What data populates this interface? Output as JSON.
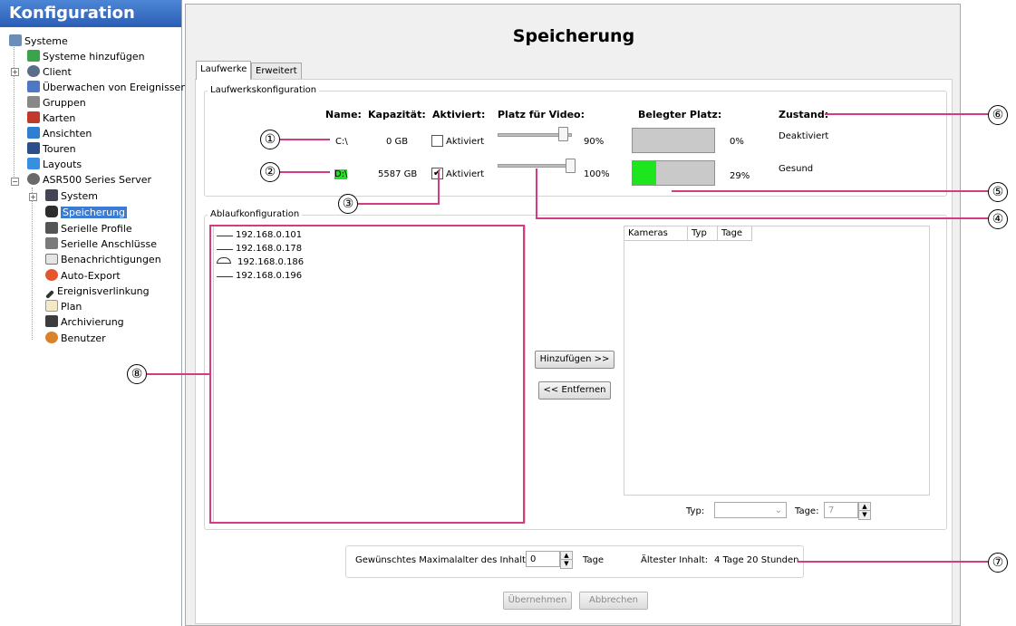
{
  "sidebar": {
    "title": "Konfiguration",
    "items": [
      {
        "label": "Systeme",
        "icon": "systems-icon"
      },
      {
        "label": "Systeme hinzufügen",
        "icon": "add-system-icon"
      },
      {
        "label": "Client",
        "icon": "client-icon"
      },
      {
        "label": "Überwachen von Ereignissen",
        "icon": "event-monitor-icon"
      },
      {
        "label": "Gruppen",
        "icon": "groups-icon"
      },
      {
        "label": "Karten",
        "icon": "maps-icon"
      },
      {
        "label": "Ansichten",
        "icon": "views-icon"
      },
      {
        "label": "Touren",
        "icon": "tours-icon"
      },
      {
        "label": "Layouts",
        "icon": "layouts-icon"
      },
      {
        "label": "ASR500 Series Server",
        "icon": "server-icon"
      },
      {
        "label": "System",
        "icon": "system-icon"
      },
      {
        "label": "Speicherung",
        "icon": "storage-icon"
      },
      {
        "label": "Serielle Profile",
        "icon": "serial-profiles-icon"
      },
      {
        "label": "Serielle Anschlüsse",
        "icon": "serial-ports-icon"
      },
      {
        "label": "Benachrichtigungen",
        "icon": "notifications-icon"
      },
      {
        "label": "Auto-Export",
        "icon": "auto-export-icon"
      },
      {
        "label": "Ereignisverlinkung",
        "icon": "event-link-icon"
      },
      {
        "label": "Plan",
        "icon": "plan-icon"
      },
      {
        "label": "Archivierung",
        "icon": "archive-icon"
      },
      {
        "label": "Benutzer",
        "icon": "user-icon"
      }
    ],
    "selected": "Speicherung"
  },
  "main": {
    "title": "Speicherung",
    "tabs": [
      {
        "label": "Laufwerke"
      },
      {
        "label": "Erweitert"
      }
    ],
    "drive_group": {
      "label": "Laufwerkskonfiguration",
      "headers": {
        "name": "Name:",
        "capacity": "Kapazität:",
        "enabled": "Aktiviert:",
        "video_space": "Platz für Video:",
        "used_space": "Belegter Platz:",
        "state": "Zustand:"
      },
      "drives": [
        {
          "name": "C:\\",
          "capacity": "0 GB",
          "enabled_label": "Aktiviert",
          "checked": false,
          "video_pct": "90%",
          "video_fraction": 0.9,
          "used_pct": "0%",
          "used_fraction": 0.0,
          "state": "Deaktiviert"
        },
        {
          "name": "D:\\",
          "capacity": "5587 GB",
          "enabled_label": "Aktiviert",
          "checked": true,
          "video_pct": "100%",
          "video_fraction": 1.0,
          "used_pct": "29%",
          "used_fraction": 0.29,
          "state": "Gesund"
        }
      ]
    },
    "schedule_group": {
      "label": "Ablaufkonfiguration",
      "cameras": [
        "192.168.0.101",
        "192.168.0.178",
        "192.168.0.186",
        "192.168.0.196"
      ],
      "add_button": "Hinzufügen >>",
      "remove_button": "<< Entfernen",
      "columns": [
        "Kameras",
        "Typ",
        "Tage"
      ],
      "type_label": "Typ:",
      "type_value": "",
      "days_label": "Tage:",
      "days_value": "7"
    },
    "retention": {
      "label": "Gewünschtes Maximalalter des Inhalts:",
      "value": "0",
      "unit": "Tage",
      "oldest_label": "Ältester Inhalt:",
      "oldest_value": "4 Tage 20 Stunden"
    },
    "buttons": {
      "apply": "Übernehmen",
      "cancel": "Abbrechen"
    }
  },
  "callouts": [
    "①",
    "②",
    "③",
    "④",
    "⑤",
    "⑥",
    "⑦",
    "⑧"
  ],
  "colors": {
    "callout_line": "#d63a83",
    "used_fill": "#1ee61e",
    "selection": "#3a7bd5",
    "header_blue": "#2a5eb5"
  }
}
